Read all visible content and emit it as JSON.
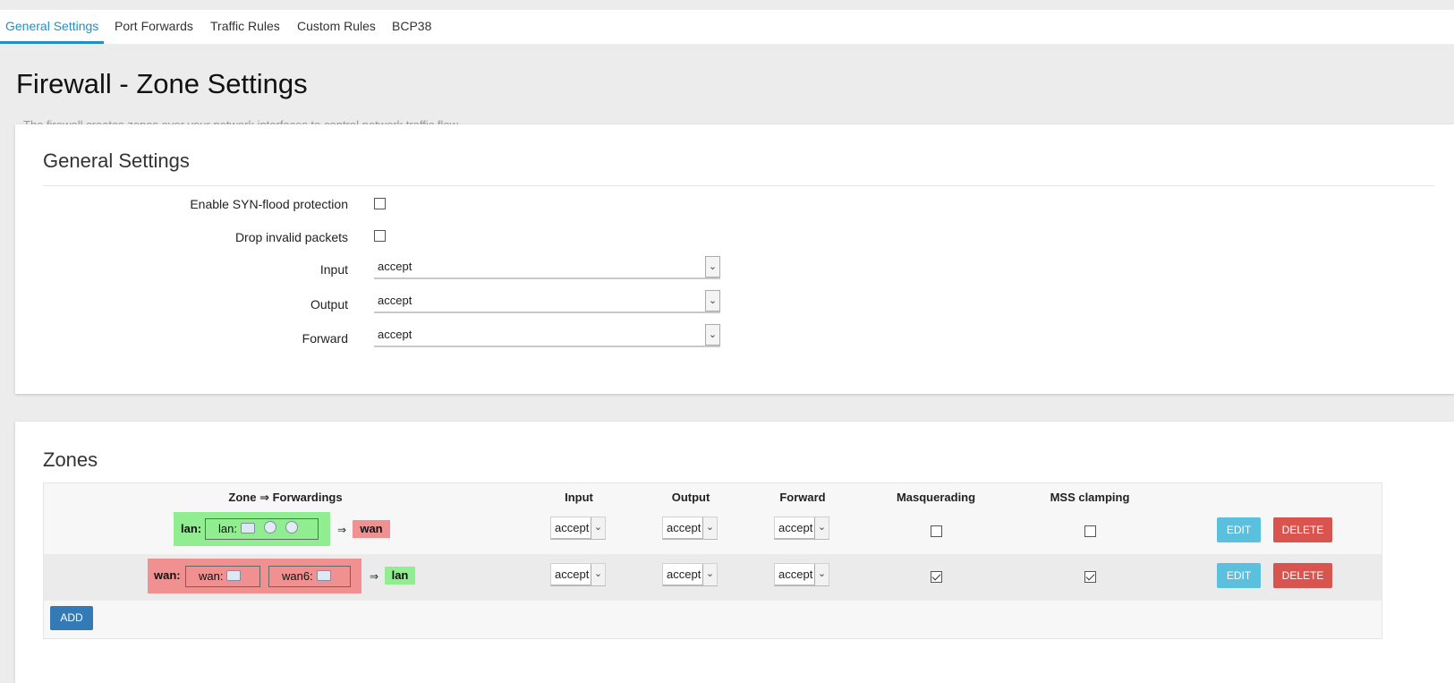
{
  "tabs": [
    {
      "label": "General Settings",
      "active": true
    },
    {
      "label": "Port Forwards",
      "active": false
    },
    {
      "label": "Traffic Rules",
      "active": false
    },
    {
      "label": "Custom Rules",
      "active": false
    },
    {
      "label": "BCP38",
      "active": false
    }
  ],
  "page": {
    "title": "Firewall - Zone Settings",
    "description": "The firewall creates zones over your network interfaces to control network traffic flow."
  },
  "general": {
    "title": "General Settings",
    "syn_flood_label": "Enable SYN-flood protection",
    "syn_flood_checked": false,
    "drop_invalid_label": "Drop invalid packets",
    "drop_invalid_checked": false,
    "input_label": "Input",
    "input_value": "accept",
    "output_label": "Output",
    "output_value": "accept",
    "forward_label": "Forward",
    "forward_value": "accept"
  },
  "zones": {
    "title": "Zones",
    "headers": {
      "zone": "Zone ⇒ Forwardings",
      "input": "Input",
      "output": "Output",
      "forward": "Forward",
      "masq": "Masquerading",
      "mss": "MSS clamping"
    },
    "rows": [
      {
        "zone_name": "lan:",
        "interfaces": [
          "lan:"
        ],
        "arrow": "⇒",
        "dest": "wan",
        "input": "accept",
        "output": "accept",
        "forward": "accept",
        "masquerading": false,
        "mss_clamping": false,
        "edit_label": "EDIT",
        "delete_label": "DELETE"
      },
      {
        "zone_name": "wan:",
        "interfaces": [
          "wan:",
          "wan6:"
        ],
        "arrow": "⇒",
        "dest": "lan",
        "input": "accept",
        "output": "accept",
        "forward": "accept",
        "masquerading": true,
        "mss_clamping": true,
        "edit_label": "EDIT",
        "delete_label": "DELETE"
      }
    ],
    "add_label": "ADD"
  },
  "colors": {
    "accent": "#1e90c9",
    "lan_zone": "#90ee90",
    "wan_zone": "#f09090",
    "edit": "#5bc0de",
    "delete": "#d9534f",
    "add": "#337ab7"
  },
  "icons": [
    "network-port-icon",
    "wireless-icon"
  ]
}
